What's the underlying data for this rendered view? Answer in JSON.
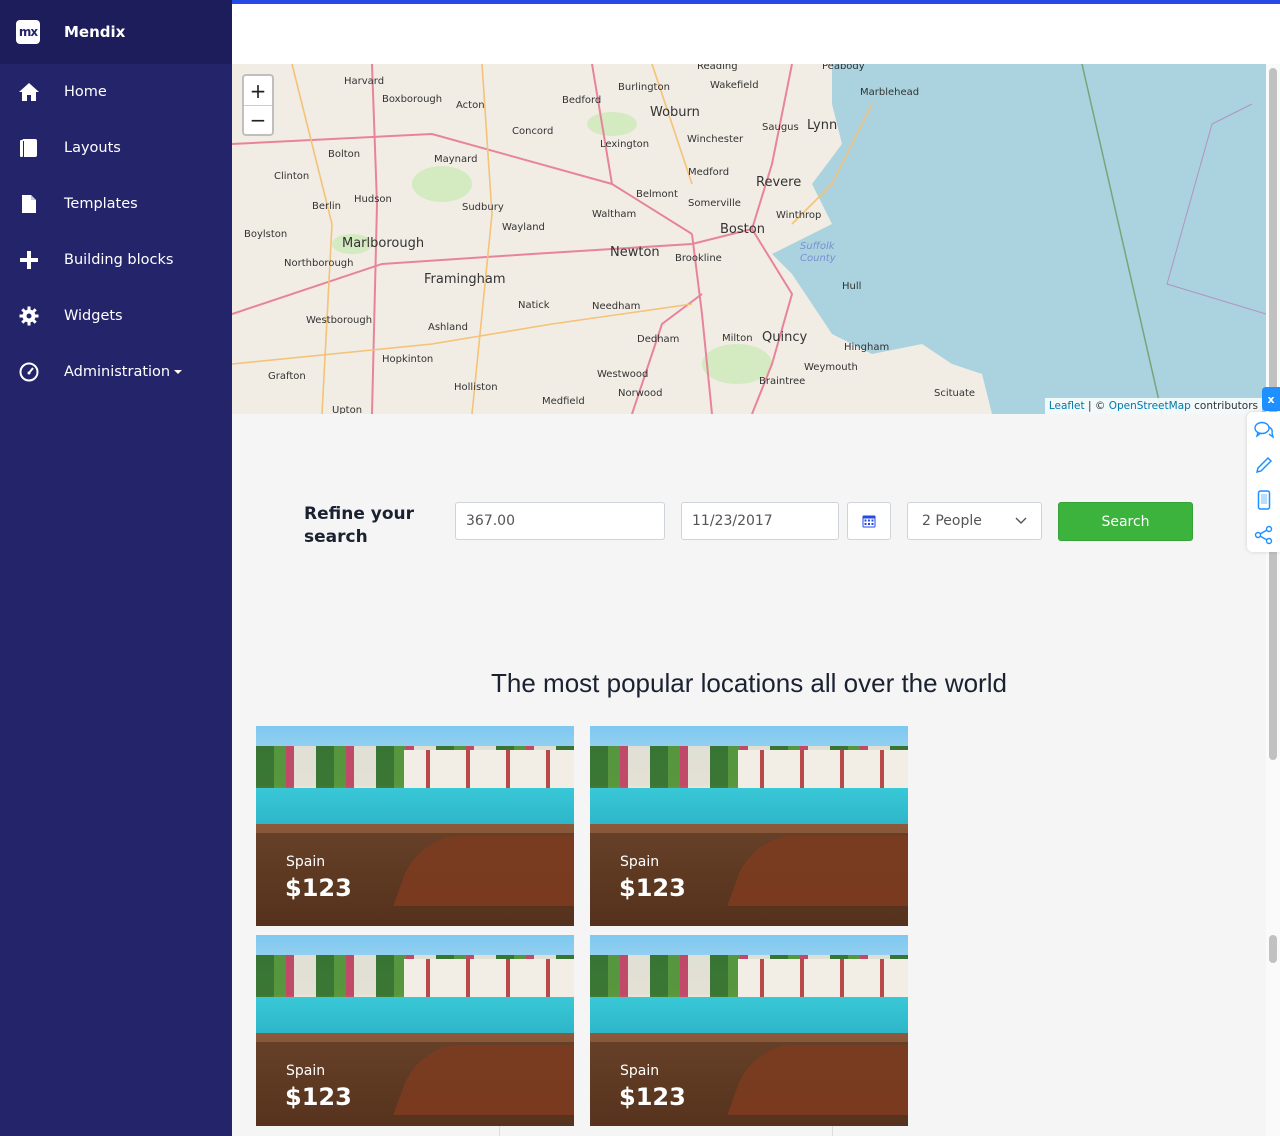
{
  "brand": {
    "logo_text": "mx",
    "name": "Mendix"
  },
  "nav": [
    {
      "label": "Home",
      "icon": "home-icon"
    },
    {
      "label": "Layouts",
      "icon": "book-icon"
    },
    {
      "label": "Templates",
      "icon": "file-icon"
    },
    {
      "label": "Building blocks",
      "icon": "plus-icon"
    },
    {
      "label": "Widgets",
      "icon": "gear-icon"
    },
    {
      "label": "Administration",
      "icon": "dashboard-icon",
      "has_dropdown": true
    }
  ],
  "map": {
    "zoom_in": "+",
    "zoom_out": "−",
    "attribution_leaflet": "Leaflet",
    "attribution_sep": "| ©",
    "attribution_osm": "OpenStreetMap",
    "attribution_suffix": "contributors",
    "places": [
      "Peabody",
      "Harvard",
      "Boxborough",
      "Acton",
      "Bedford",
      "Burlington",
      "Reading",
      "Wakefield",
      "Marblehead",
      "Woburn",
      "Concord",
      "Saugus",
      "Lynn",
      "Winchester",
      "Lexington",
      "Bolton",
      "Maynard",
      "Medford",
      "Revere",
      "Clinton",
      "Belmont",
      "Somerville",
      "Berlin",
      "Hudson",
      "Sudbury",
      "Waltham",
      "Winthrop",
      "Boylston",
      "Wayland",
      "Boston",
      "Marlborough",
      "Newton",
      "Brookline",
      "Suffolk County",
      "Northborough",
      "Framingham",
      "Natick",
      "Needham",
      "Hull",
      "Westborough",
      "Ashland",
      "Dedham",
      "Milton",
      "Quincy",
      "Hingham",
      "Hopkinton",
      "Weymouth",
      "Grafton",
      "Westwood",
      "Braintree",
      "Holliston",
      "Norwood",
      "Scituate",
      "Medfield",
      "Upton"
    ]
  },
  "search": {
    "heading_line1": "Refine your",
    "heading_line2": "search",
    "price_value": "367.00",
    "date_value": "11/23/2017",
    "people_value": "2 People",
    "button_label": "Search"
  },
  "popular": {
    "title": "The most popular locations all over the world",
    "cards": [
      {
        "country": "Spain",
        "price": "$123"
      },
      {
        "country": "Spain",
        "price": "$123"
      },
      {
        "country": "Spain",
        "price": "$123"
      },
      {
        "country": "Spain",
        "price": "$123"
      }
    ]
  },
  "side_tools": {
    "tab_label": "x",
    "icons": [
      "chat-icon",
      "pencil-icon",
      "mobile-icon",
      "share-icon"
    ]
  },
  "colors": {
    "sidebar": "#24246b",
    "accent": "#264ae5",
    "search_button": "#3cb33d"
  }
}
